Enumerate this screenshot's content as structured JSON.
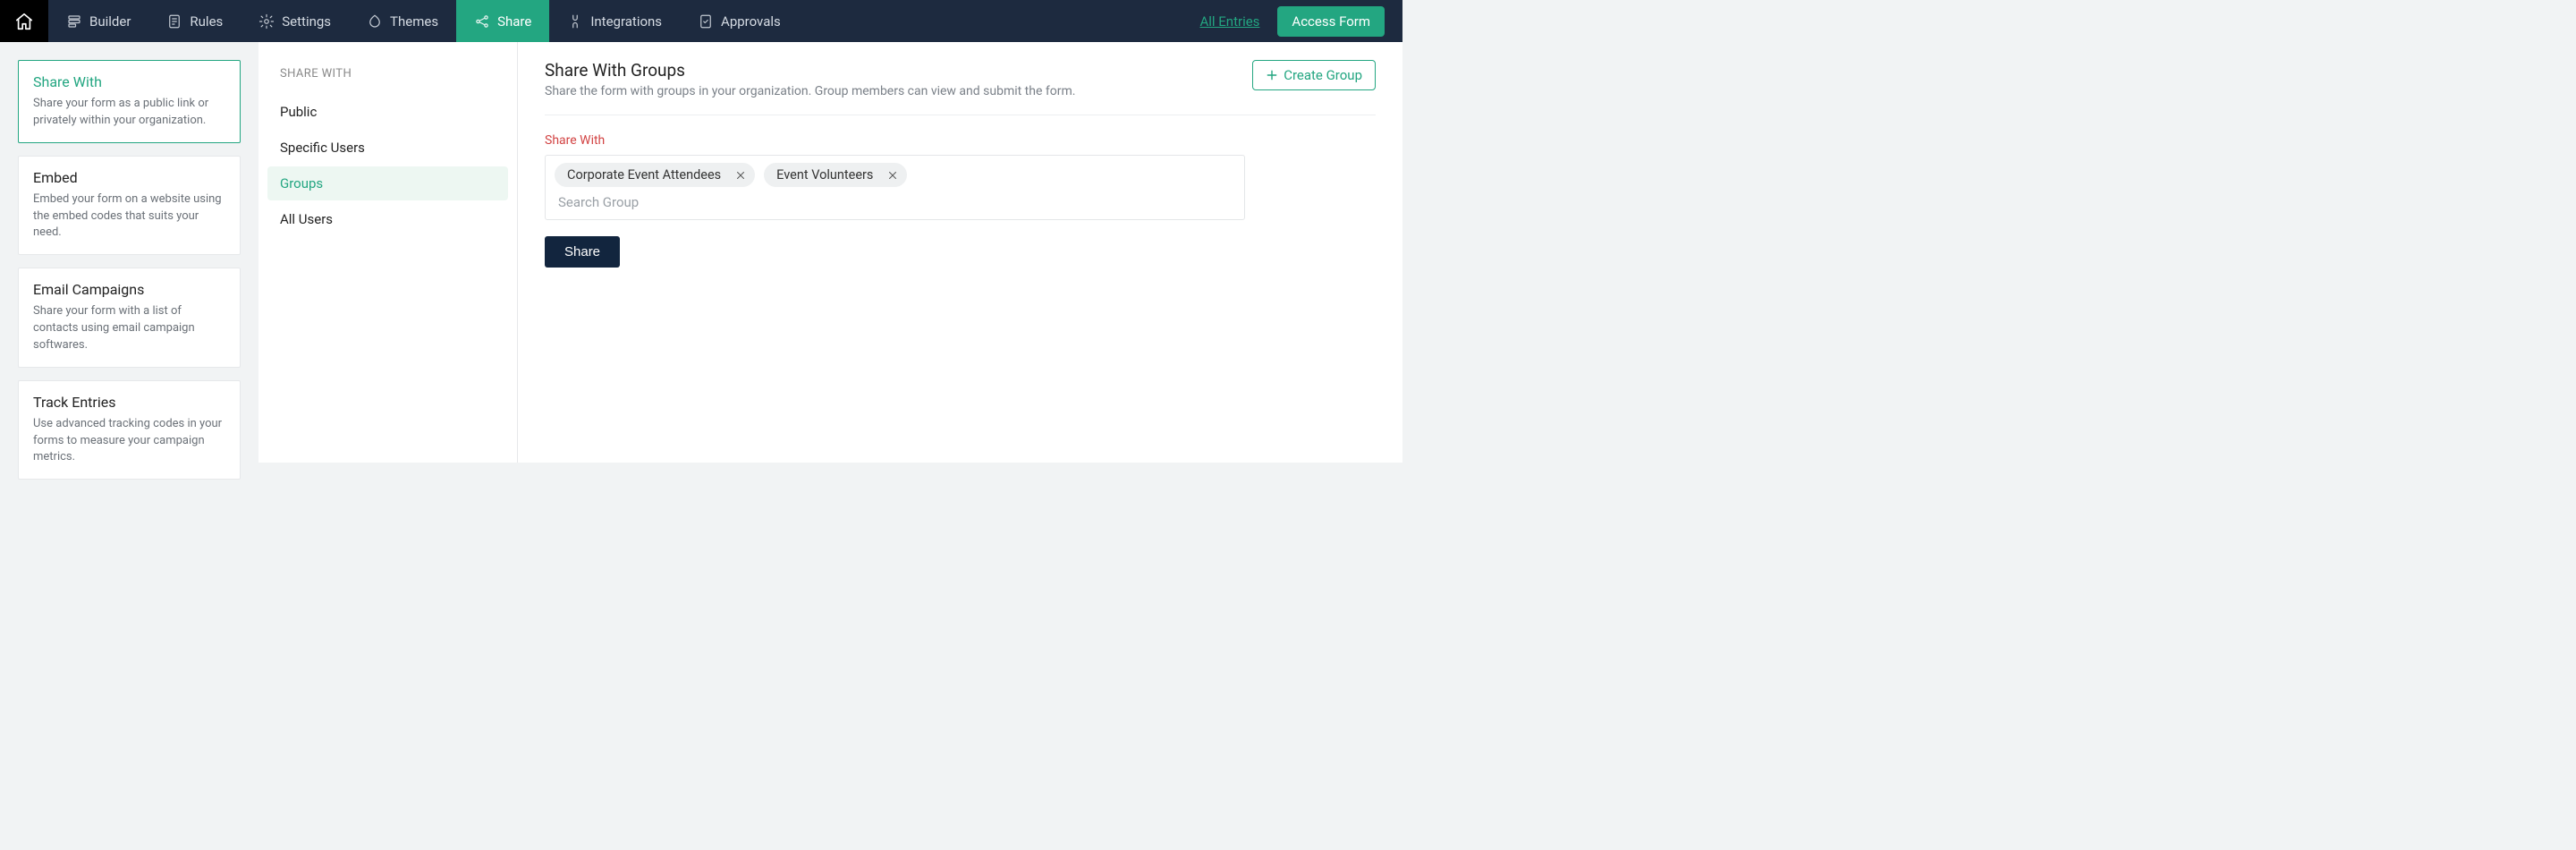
{
  "topnav": {
    "tabs": [
      {
        "id": "builder",
        "label": "Builder"
      },
      {
        "id": "rules",
        "label": "Rules"
      },
      {
        "id": "settings",
        "label": "Settings"
      },
      {
        "id": "themes",
        "label": "Themes"
      },
      {
        "id": "share",
        "label": "Share",
        "active": true
      },
      {
        "id": "integrations",
        "label": "Integrations"
      },
      {
        "id": "approvals",
        "label": "Approvals"
      }
    ],
    "all_entries": "All Entries",
    "access_form": "Access Form"
  },
  "left_cards": [
    {
      "id": "share-with",
      "title": "Share With",
      "desc": "Share your form as a public link or privately within your organization.",
      "active": true
    },
    {
      "id": "embed",
      "title": "Embed",
      "desc": "Embed your form on a website using the embed codes that suits your need."
    },
    {
      "id": "email-campaigns",
      "title": "Email Campaigns",
      "desc": "Share your form with a list of contacts using email campaign softwares."
    },
    {
      "id": "track-entries",
      "title": "Track Entries",
      "desc": "Use advanced tracking codes in your forms to measure your campaign metrics."
    }
  ],
  "mid": {
    "title": "SHARE WITH",
    "items": [
      {
        "id": "public",
        "label": "Public"
      },
      {
        "id": "specific-users",
        "label": "Specific Users"
      },
      {
        "id": "groups",
        "label": "Groups",
        "active": true
      },
      {
        "id": "all-users",
        "label": "All Users"
      }
    ]
  },
  "main": {
    "title": "Share With Groups",
    "subtitle": "Share the form with groups in your organization. Group members can view and submit the form.",
    "create_group": "Create Group",
    "field_label": "Share With",
    "chips": [
      "Corporate Event Attendees",
      "Event Volunteers"
    ],
    "search_placeholder": "Search Group",
    "share_button": "Share"
  }
}
